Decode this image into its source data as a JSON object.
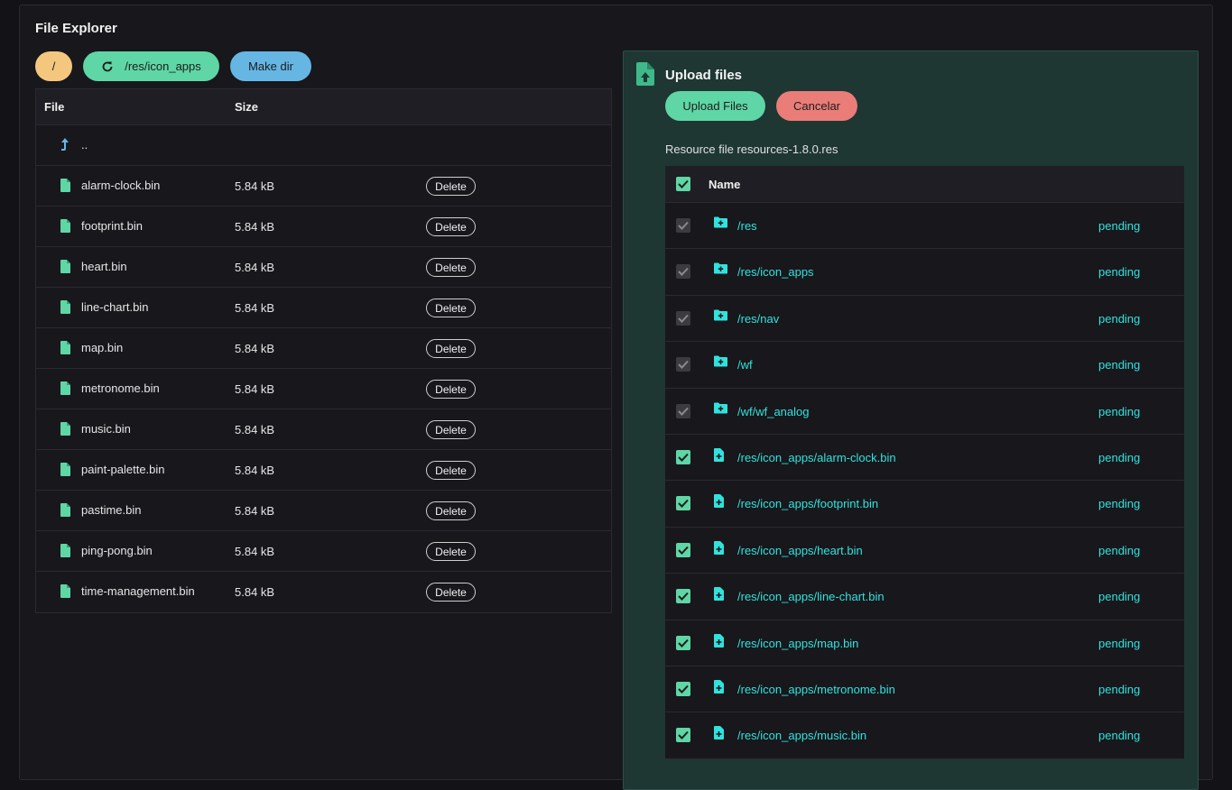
{
  "explorer": {
    "title": "File Explorer",
    "root_label": "/",
    "path_label": "/res/icon_apps",
    "mkdir_label": "Make dir",
    "columns": {
      "file": "File",
      "size": "Size"
    },
    "parent_label": "..",
    "delete_label": "Delete",
    "files": [
      {
        "name": "alarm-clock.bin",
        "size": "5.84 kB"
      },
      {
        "name": "footprint.bin",
        "size": "5.84 kB"
      },
      {
        "name": "heart.bin",
        "size": "5.84 kB"
      },
      {
        "name": "line-chart.bin",
        "size": "5.84 kB"
      },
      {
        "name": "map.bin",
        "size": "5.84 kB"
      },
      {
        "name": "metronome.bin",
        "size": "5.84 kB"
      },
      {
        "name": "music.bin",
        "size": "5.84 kB"
      },
      {
        "name": "paint-palette.bin",
        "size": "5.84 kB"
      },
      {
        "name": "pastime.bin",
        "size": "5.84 kB"
      },
      {
        "name": "ping-pong.bin",
        "size": "5.84 kB"
      },
      {
        "name": "time-management.bin",
        "size": "5.84 kB"
      }
    ]
  },
  "upload": {
    "title": "Upload files",
    "upload_button": "Upload Files",
    "cancel_button": "Cancelar",
    "description": "Resource file resources-1.8.0.res",
    "name_header": "Name",
    "items": [
      {
        "path": "/res",
        "status": "pending",
        "kind": "folder",
        "checked": false
      },
      {
        "path": "/res/icon_apps",
        "status": "pending",
        "kind": "folder",
        "checked": false
      },
      {
        "path": "/res/nav",
        "status": "pending",
        "kind": "folder",
        "checked": false
      },
      {
        "path": "/wf",
        "status": "pending",
        "kind": "folder",
        "checked": false
      },
      {
        "path": "/wf/wf_analog",
        "status": "pending",
        "kind": "folder",
        "checked": false
      },
      {
        "path": "/res/icon_apps/alarm-clock.bin",
        "status": "pending",
        "kind": "file",
        "checked": true
      },
      {
        "path": "/res/icon_apps/footprint.bin",
        "status": "pending",
        "kind": "file",
        "checked": true
      },
      {
        "path": "/res/icon_apps/heart.bin",
        "status": "pending",
        "kind": "file",
        "checked": true
      },
      {
        "path": "/res/icon_apps/line-chart.bin",
        "status": "pending",
        "kind": "file",
        "checked": true
      },
      {
        "path": "/res/icon_apps/map.bin",
        "status": "pending",
        "kind": "file",
        "checked": true
      },
      {
        "path": "/res/icon_apps/metronome.bin",
        "status": "pending",
        "kind": "file",
        "checked": true
      },
      {
        "path": "/res/icon_apps/music.bin",
        "status": "pending",
        "kind": "file",
        "checked": true
      }
    ]
  },
  "colors": {
    "background": "#131217",
    "accent_green": "#5fd6a5",
    "accent_yellow": "#f4c77f",
    "accent_blue": "#66b6e4",
    "accent_red": "#ea7d78",
    "status_cyan": "#31e2dc",
    "upload_panel": "#1e3733"
  }
}
